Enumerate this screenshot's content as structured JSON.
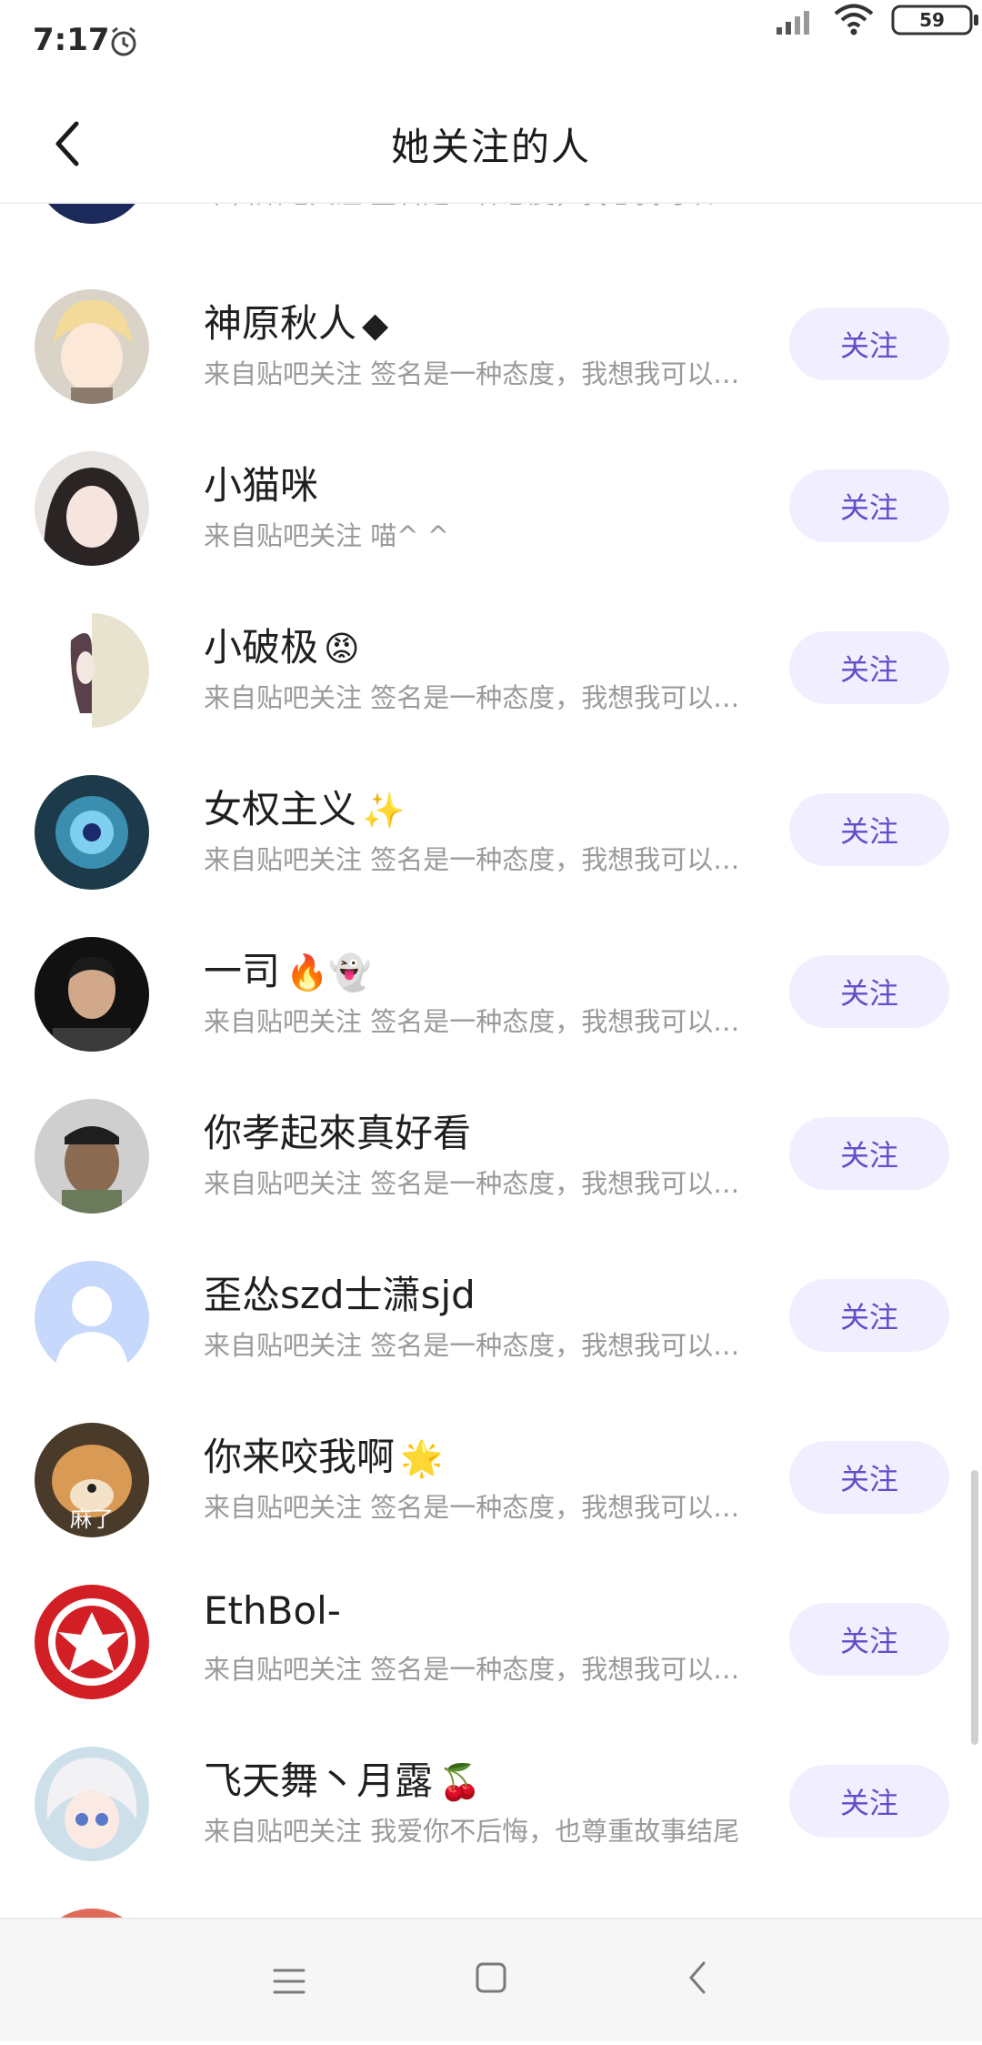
{
  "status_bar": {
    "time": "7:17",
    "battery": "59"
  },
  "header": {
    "title": "她关注的人"
  },
  "follow_label": "关注",
  "list": [
    {
      "name": "",
      "emoji": "",
      "desc": "来自贴吧关注 签名是一种态度，我想我可以…",
      "avatar": "avatar-cropped"
    },
    {
      "name": "神原秋人",
      "emoji": "◆",
      "desc": "来自贴吧关注 签名是一种态度，我想我可以…",
      "avatar": "anime-boy"
    },
    {
      "name": "小猫咪",
      "emoji": "",
      "desc": "来自贴吧关注 喵^ ^",
      "avatar": "girl-photo"
    },
    {
      "name": "小破极",
      "emoji": "😡",
      "desc": "来自贴吧关注 签名是一种态度，我想我可以…",
      "avatar": "half-face"
    },
    {
      "name": "女权主义",
      "emoji": "✨",
      "desc": "来自贴吧关注 签名是一种态度，我想我可以…",
      "avatar": "blue-orb"
    },
    {
      "name": "一司",
      "emoji": "🔥👻",
      "desc": "来自贴吧关注 签名是一种态度，我想我可以…",
      "avatar": "man-photo"
    },
    {
      "name": "你孝起來真好看",
      "emoji": "",
      "desc": "来自贴吧关注 签名是一种态度，我想我可以…",
      "avatar": "ape"
    },
    {
      "name": "歪怂szd士潇sjd",
      "emoji": "",
      "desc": "来自贴吧关注 签名是一种态度，我想我可以…",
      "avatar": "default"
    },
    {
      "name": "你来咬我啊",
      "emoji": "🌟",
      "desc": "来自贴吧关注 签名是一种态度，我想我可以…",
      "avatar": "dog"
    },
    {
      "name": "EthBol-",
      "emoji": "",
      "desc": "来自贴吧关注 签名是一种态度，我想我可以…",
      "avatar": "red-emblem"
    },
    {
      "name": "飞天舞丶月露",
      "emoji": "🍒",
      "desc": "来自贴吧关注 我爱你不后悔，也尊重故事结尾",
      "avatar": "anime-girl"
    }
  ],
  "avatar_overlay_text": "麻了"
}
